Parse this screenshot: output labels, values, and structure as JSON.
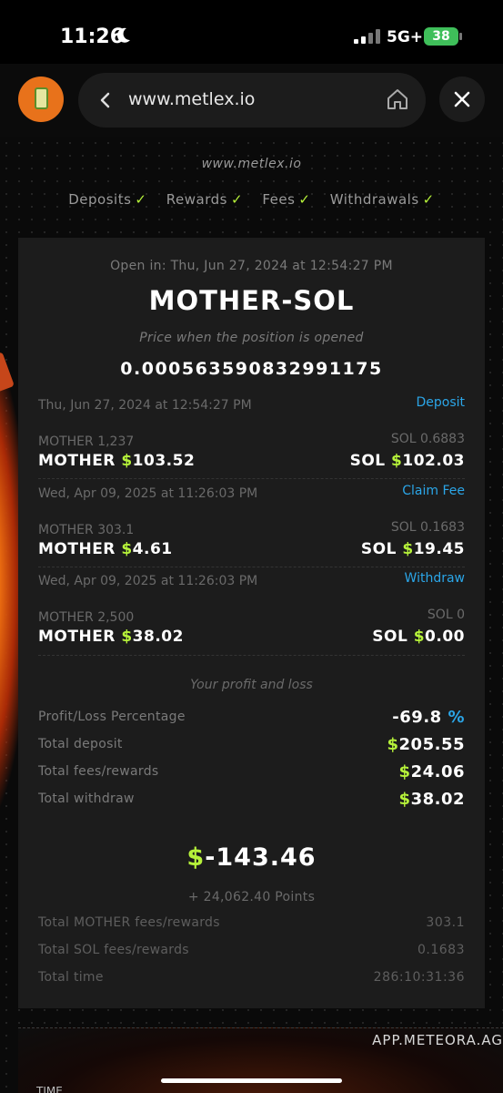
{
  "status_bar": {
    "time": "11:26",
    "network": "5G+",
    "battery": "38"
  },
  "browser": {
    "url": "www.metlex.io"
  },
  "page": {
    "site_name": "www.metlex.io",
    "checks": [
      {
        "label": "Deposits",
        "tick": "✓"
      },
      {
        "label": "Rewards",
        "tick": "✓"
      },
      {
        "label": "Fees",
        "tick": "✓"
      },
      {
        "label": "Withdrawals",
        "tick": "✓"
      }
    ]
  },
  "position": {
    "open_in": "Open in: Thu, Jun 27, 2024 at 12:54:27 PM",
    "pair": "MOTHER-SOL",
    "price_label": "Price when the position is opened",
    "price_value": "0.000563590832991175",
    "transactions": [
      {
        "date": "Thu, Jun 27, 2024 at 12:54:27 PM",
        "action": "Deposit",
        "left_amount": "MOTHER 1,237",
        "right_amount": "SOL 0.6883",
        "left_token": "MOTHER ",
        "left_usd": "103.52",
        "right_token": "SOL ",
        "right_usd": "102.03"
      },
      {
        "date": "Wed, Apr 09, 2025 at 11:26:03 PM",
        "action": "Claim Fee",
        "left_amount": "MOTHER 303.1",
        "right_amount": "SOL 0.1683",
        "left_token": "MOTHER ",
        "left_usd": "4.61",
        "right_token": "SOL ",
        "right_usd": "19.45"
      },
      {
        "date": "Wed, Apr 09, 2025 at 11:26:03 PM",
        "action": "Withdraw",
        "left_amount": "MOTHER 2,500",
        "right_amount": "SOL 0",
        "left_token": "MOTHER ",
        "left_usd": "38.02",
        "right_token": "SOL ",
        "right_usd": "0.00"
      }
    ],
    "dollar_sign": "$",
    "pl_title": "Your profit and loss",
    "stats": [
      {
        "label": "Profit/Loss Percentage",
        "value": "-69.8",
        "suffix": " %"
      },
      {
        "label": "Total deposit",
        "value": "205.55"
      },
      {
        "label": "Total fees/rewards",
        "value": "24.06"
      },
      {
        "label": "Total withdraw",
        "value": "38.02"
      }
    ],
    "pnl": "-143.46",
    "points": "+ 24,062.40 Points",
    "extra_stats": [
      {
        "label": "Total MOTHER fees/rewards",
        "value": "303.1"
      },
      {
        "label": "Total SOL fees/rewards",
        "value": "0.1683"
      },
      {
        "label": "Total time",
        "value": "286:10:31:36"
      }
    ]
  },
  "bottom_card": {
    "brand": "APP.METEORA.AG",
    "label": "TIME"
  },
  "icons": {
    "moon": "moon-icon",
    "back": "chevron-left-icon",
    "home": "home-icon",
    "close": "close-icon",
    "app": "battery-can-icon"
  }
}
